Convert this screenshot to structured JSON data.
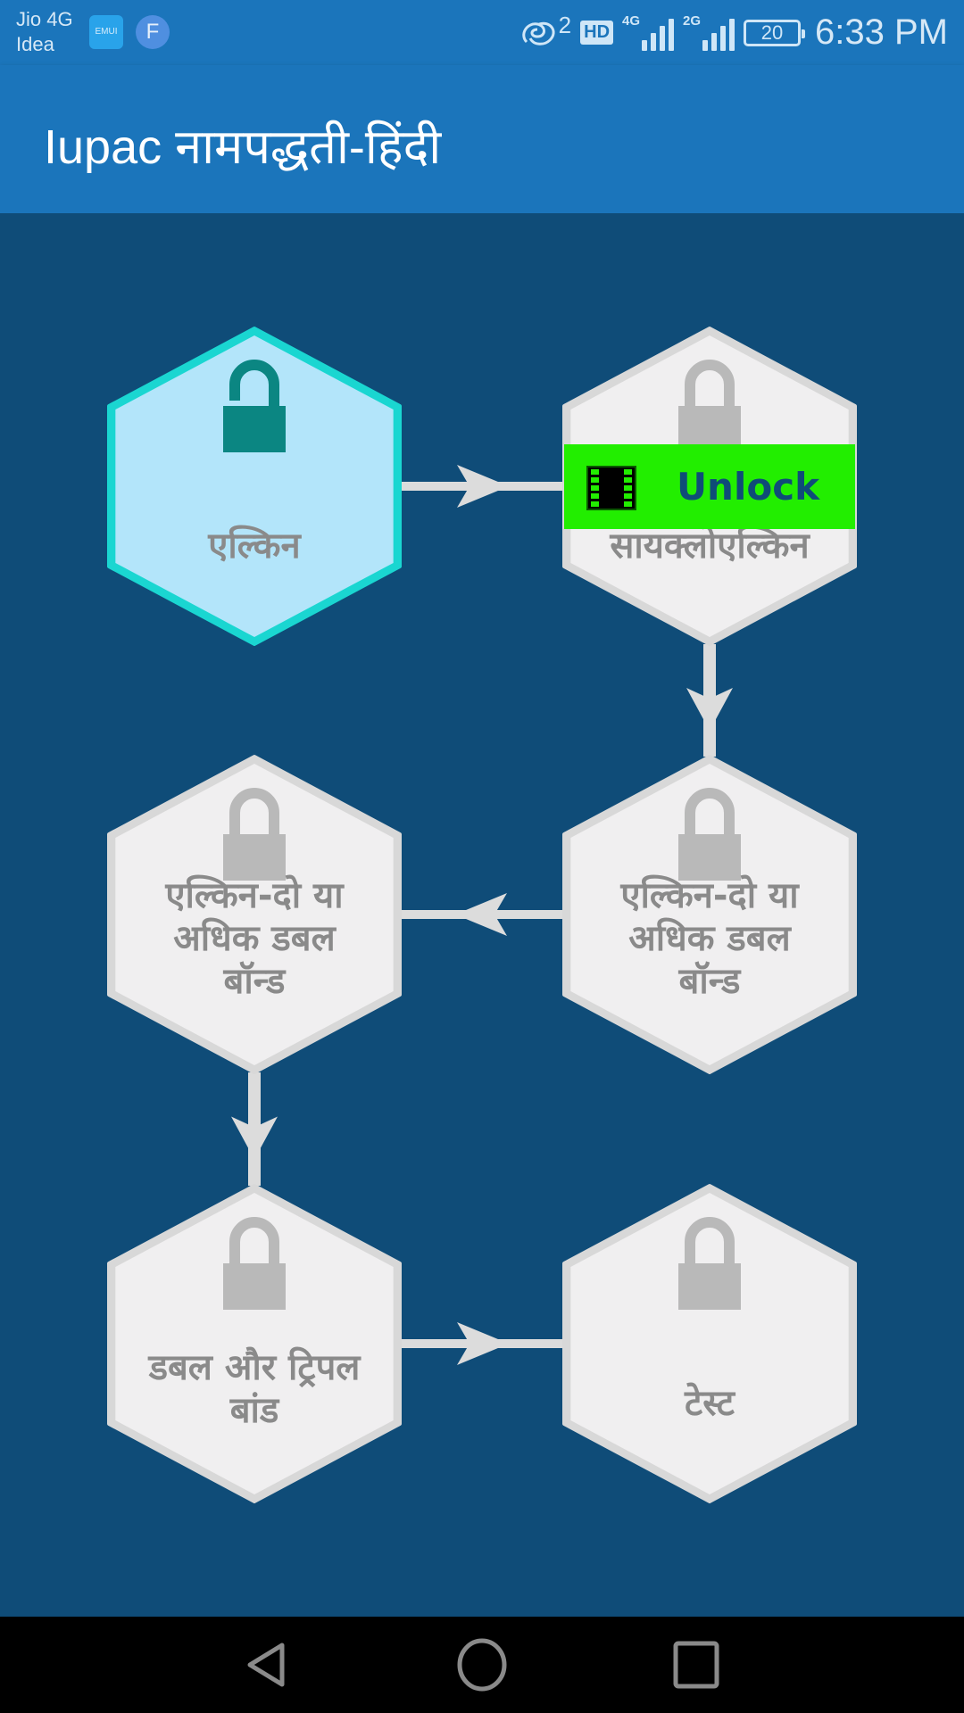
{
  "status_bar": {
    "carrier_1": "Jio 4G",
    "carrier_2": "Idea",
    "app_icon_1": "EMUI",
    "app_icon_2": "F",
    "sync_count": "2",
    "hd_label": "HD",
    "network_1": "4G",
    "network_2": "2G",
    "battery_level": "20",
    "time": "6:33 PM"
  },
  "app_bar": {
    "title": "Iupac नामपद्धती-हिंदी"
  },
  "colors": {
    "app_bar": "#1b75bb",
    "background": "#0f4c78",
    "unlocked_fill": "#b3e5fa",
    "unlocked_border": "#1ad6d1",
    "unlocked_lock": "#0b8682",
    "locked_fill": "#f0eff0",
    "locked_border": "#d8d8d8",
    "locked_lock": "#b9b9b9",
    "label_text": "#8a8a8a",
    "unlock_bar": "#22ee00",
    "unlock_text": "#0f4c78"
  },
  "levels": [
    {
      "id": "alkene",
      "label_lines": [
        "एल्किन"
      ],
      "state": "unlocked"
    },
    {
      "id": "cycloalkene",
      "label_lines": [
        "सायक्लोएल्किन"
      ],
      "state": "locked",
      "unlock_button": "Unlock"
    },
    {
      "id": "alkene-multi-right",
      "label_lines": [
        "एल्किन-दो या",
        "अधिक डबल",
        "बॉन्ड"
      ],
      "state": "locked"
    },
    {
      "id": "alkene-multi-left",
      "label_lines": [
        "एल्किन-दो या",
        "अधिक डबल",
        "बॉन्ड"
      ],
      "state": "locked"
    },
    {
      "id": "double-triple",
      "label_lines": [
        "डबल और ट्रिपल",
        "बांड"
      ],
      "state": "locked"
    },
    {
      "id": "test",
      "label_lines": [
        "टेस्ट"
      ],
      "state": "locked"
    }
  ],
  "nav_bar": {
    "back": "back-icon",
    "home": "home-icon",
    "recents": "recents-icon"
  }
}
